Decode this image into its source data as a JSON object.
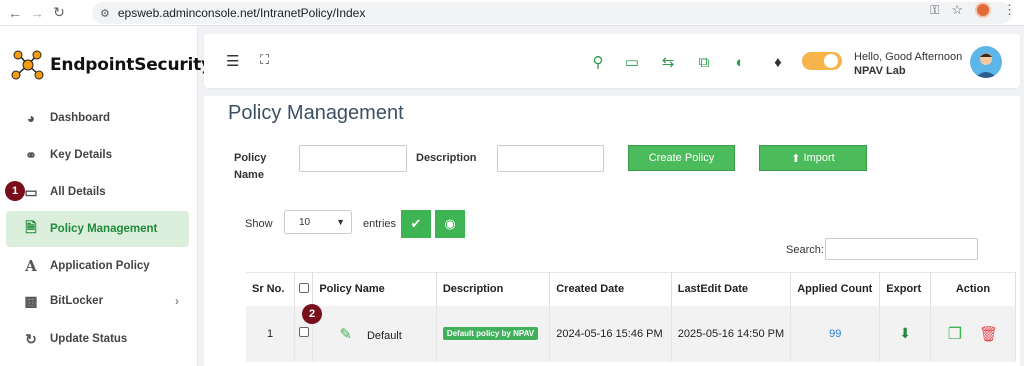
{
  "browser": {
    "url": "epsweb.adminconsole.net/IntranetPolicy/Index"
  },
  "sidebar": {
    "logo_text": "EndpointSecurity",
    "items": [
      {
        "label": "Dashboard",
        "icon": "pie-chart-icon"
      },
      {
        "label": "Key Details",
        "icon": "key-icon"
      },
      {
        "label": "All Details",
        "icon": "monitor-icon"
      },
      {
        "label": "Policy Management",
        "icon": "document-icon",
        "active": true
      },
      {
        "label": "Application Policy",
        "icon": "font-a-icon"
      },
      {
        "label": "BitLocker",
        "icon": "network-icon"
      },
      {
        "label": "Update Status",
        "icon": "refresh-icon"
      }
    ]
  },
  "steps": {
    "one": "1",
    "two": "2"
  },
  "header": {
    "greeting": "Hello, Good Afternoon",
    "user": "NPAV Lab"
  },
  "main": {
    "title": "Policy Management",
    "policy_name_label": "Policy Name",
    "description_label": "Description",
    "create_button": "Create Policy",
    "import_button": "Import",
    "show_label": "Show",
    "entries_value": "10",
    "entries_label": "entries",
    "search_label": "Search:"
  },
  "table": {
    "columns": [
      "Sr No.",
      "",
      "Policy Name",
      "Description",
      "Created Date",
      "LastEdit Date",
      "Applied Count",
      "Export",
      "Action"
    ],
    "rows": [
      {
        "sr": "1",
        "name": "Default",
        "description": "Default policy by NPAV",
        "created": "2024-05-16 15:46 PM",
        "edited": "2025-05-16 14:50 PM",
        "count": "99"
      }
    ]
  },
  "colors": {
    "brand_green": "#4cbb5c",
    "active_bg": "#dcefdc",
    "badge": "#7a0f1c",
    "delete_red": "#e5484d"
  }
}
